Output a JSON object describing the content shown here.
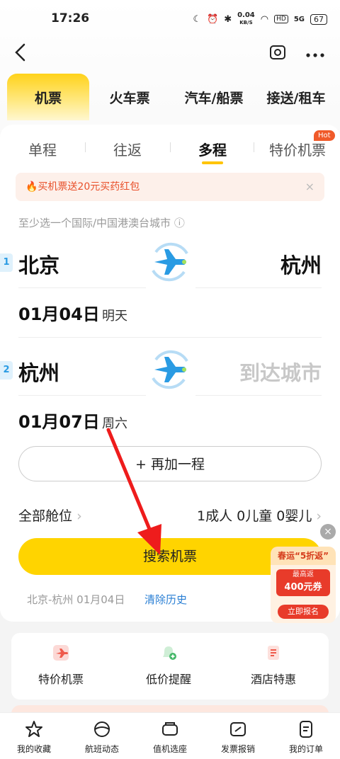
{
  "status": {
    "time": "17:26",
    "net_speed": "0.04",
    "net_unit": "KB/S",
    "hd": "HD",
    "signal": "5G",
    "battery": "67"
  },
  "nav": {
    "back_icon": "back-arrow-icon",
    "camera_icon": "camera-icon",
    "more_icon": "more-icon"
  },
  "top_tabs": [
    "机票",
    "火车票",
    "汽车/船票",
    "接送/租车"
  ],
  "sub_tabs": {
    "items": [
      "单程",
      "往返",
      "多程",
      "特价机票"
    ],
    "hot": "Hot"
  },
  "promo": {
    "text": "🔥买机票送20元买药红包",
    "close": "×"
  },
  "hint": "至少选一个国际/中国港澳台城市 ⓘ",
  "segments": [
    {
      "num": "1",
      "from": "北京",
      "to": "杭州",
      "date": "01月04日",
      "day": "明天"
    },
    {
      "num": "2",
      "from": "杭州",
      "to": "到达城市",
      "date": "01月07日",
      "day": "周六"
    }
  ],
  "add_leg": "+ 再加一程",
  "cabin": {
    "label": "全部舱位",
    "passengers": "1成人 0儿童 0婴儿",
    "chev": "›"
  },
  "search_btn": "搜索机票",
  "history": {
    "item": "北京-杭州 01月04日",
    "clear": "清除历史"
  },
  "ad": {
    "title": "春运“5折返”",
    "line1": "最高返",
    "line2": "400元券",
    "cta": "立即报名",
    "close": "×"
  },
  "features": [
    {
      "label": "特价机票",
      "icon": "discount-flight-icon"
    },
    {
      "label": "低价提醒",
      "icon": "price-alert-bell-icon"
    },
    {
      "label": "酒店特惠",
      "icon": "hotel-deal-icon"
    }
  ],
  "bottom_nav": [
    {
      "label": "我的收藏",
      "icon": "star-icon"
    },
    {
      "label": "航班动态",
      "icon": "flight-status-icon"
    },
    {
      "label": "值机选座",
      "icon": "seat-icon"
    },
    {
      "label": "发票报销",
      "icon": "invoice-icon"
    },
    {
      "label": "我的订单",
      "icon": "order-icon"
    }
  ],
  "colors": {
    "accent": "#ffd400",
    "promo": "#e8502a",
    "link": "#2a7fd4",
    "plane": "#2a9be3"
  }
}
